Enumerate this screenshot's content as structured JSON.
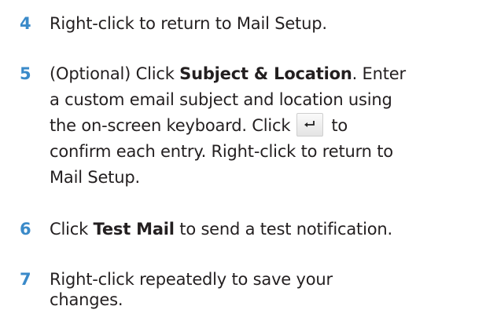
{
  "steps": [
    {
      "number": "4",
      "lines": [
        [
          "Right-click to return to Mail Setup."
        ]
      ]
    },
    {
      "number": "5",
      "line1_a": "(Optional) Click ",
      "line1_bold": "Subject & Location",
      "line1_b": ". Enter",
      "line2": "a custom email subject and location using",
      "line3_a": "the on-screen keyboard. Click",
      "line3_b": "to",
      "line4": "confirm each entry. Right-click to return to",
      "line5": "Mail Setup."
    },
    {
      "number": "6",
      "line1_a": "Click ",
      "line1_bold": "Test Mail",
      "line1_b": " to send a test notification."
    },
    {
      "number": "7",
      "line1": "Right-click repeatedly to save your",
      "line2": "changes."
    }
  ],
  "step4_text": "Right-click to return to Mail Setup.",
  "icons": {
    "enter": "enter-key-icon"
  },
  "colors": {
    "step_number": "#3a8ac9",
    "text": "#231f20"
  }
}
